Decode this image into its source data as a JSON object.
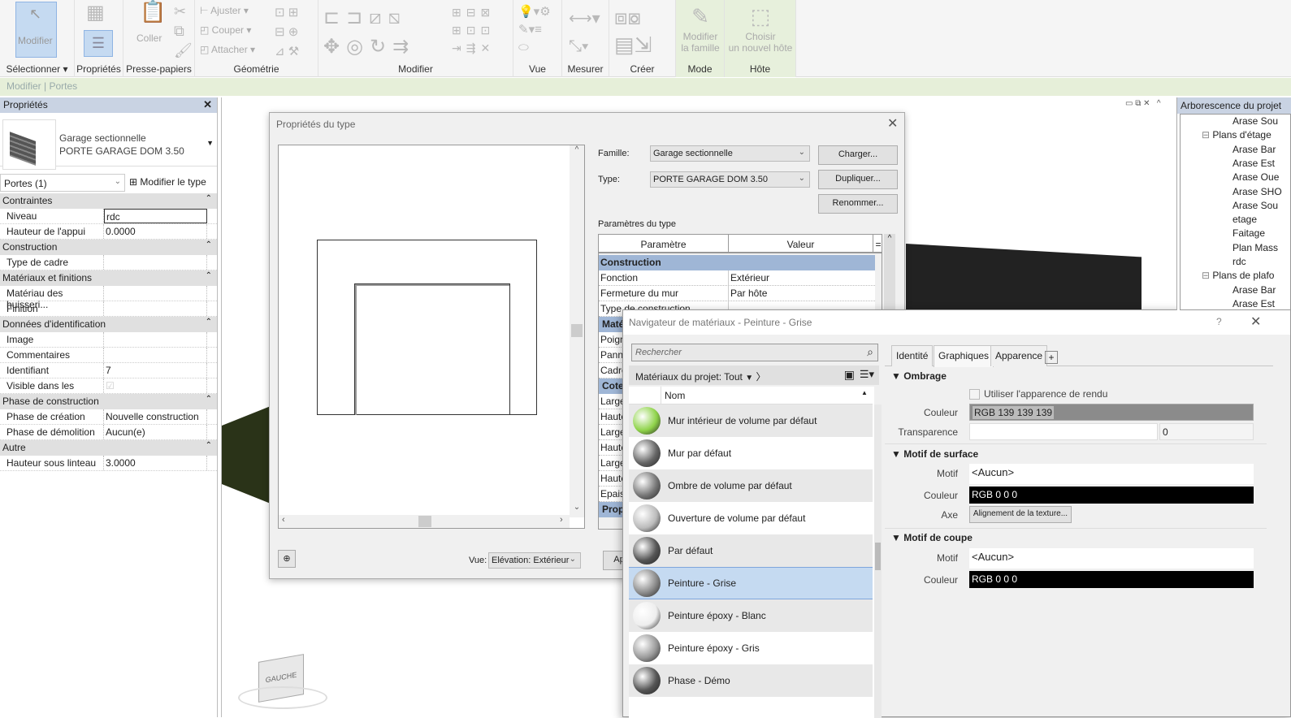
{
  "ribbon": {
    "modify": "Modifier",
    "coller": "Coller",
    "ajuster": "Ajuster",
    "couper": "Couper",
    "attacher": "Attacher",
    "modifier_famille_1": "Modifier",
    "modifier_famille_2": "la famille",
    "choisir_hote_1": "Choisir",
    "choisir_hote_2": "un nouvel hôte",
    "panels": [
      "Sélectionner ▾",
      "Propriétés",
      "Presse-papiers",
      "Géométrie",
      "Modifier",
      "Vue",
      "Mesurer",
      "Créer",
      "Mode",
      "Hôte"
    ]
  },
  "context_bar": "Modifier | Portes",
  "properties": {
    "title": "Propriétés",
    "family": "Garage sectionnelle",
    "type": "PORTE GARAGE DOM 3.50",
    "filter": "Portes (1)",
    "edit_type": "Modifier le type",
    "groups": [
      {
        "name": "Contraintes",
        "rows": [
          [
            "Niveau",
            "rdc"
          ],
          [
            "Hauteur de l'appui",
            "0.0000"
          ]
        ]
      },
      {
        "name": "Construction",
        "rows": [
          [
            "Type de cadre",
            ""
          ]
        ]
      },
      {
        "name": "Matériaux et finitions",
        "rows": [
          [
            "Matériau des huisseri...",
            ""
          ],
          [
            "Finition",
            ""
          ]
        ]
      },
      {
        "name": "Données d'identification",
        "rows": [
          [
            "Image",
            ""
          ],
          [
            "Commentaires",
            ""
          ],
          [
            "Identifiant",
            "7"
          ],
          [
            "Visible dans les nom...",
            "☑"
          ]
        ]
      },
      {
        "name": "Phase de construction",
        "rows": [
          [
            "Phase de création",
            "Nouvelle construction"
          ],
          [
            "Phase de démolition",
            "Aucun(e)"
          ]
        ]
      },
      {
        "name": "Autre",
        "rows": [
          [
            "Hauteur sous linteau",
            "3.0000"
          ]
        ]
      }
    ]
  },
  "type_props": {
    "title": "Propriétés du type",
    "famille_label": "Famille:",
    "famille": "Garage sectionnelle",
    "type_label": "Type:",
    "type": "PORTE GARAGE DOM 3.50",
    "charger": "Charger...",
    "dupliquer": "Dupliquer...",
    "renommer": "Renommer...",
    "params_label": "Paramètres du type",
    "col_param": "Paramètre",
    "col_value": "Valeur",
    "col_eq": "=",
    "construction_header": "Construction",
    "construction_rows": [
      [
        "Fonction",
        "Extérieur"
      ],
      [
        "Fermeture du mur",
        "Par hôte"
      ],
      [
        "Type de construction",
        ""
      ]
    ],
    "partial": [
      {
        "t": "g",
        "s": "Maté"
      },
      {
        "t": "r",
        "s": "Poign"
      },
      {
        "t": "r",
        "s": "Panne"
      },
      {
        "t": "r",
        "s": "Cadre"
      },
      {
        "t": "g",
        "s": "Cotes"
      },
      {
        "t": "r",
        "s": "Large"
      },
      {
        "t": "r",
        "s": "Haute"
      },
      {
        "t": "r",
        "s": "Large"
      },
      {
        "t": "r",
        "s": "Haute"
      },
      {
        "t": "r",
        "s": "Large"
      },
      {
        "t": "r",
        "s": "Haute"
      },
      {
        "t": "r",
        "s": "Epais"
      },
      {
        "t": "g",
        "s": "Prop"
      }
    ],
    "view_label": "Vue:",
    "view": "Elévation: Extérieur",
    "apply": "Ap"
  },
  "material_browser": {
    "title": "Navigateur de matériaux - Peinture - Grise",
    "help": "?",
    "search_placeholder": "Rechercher",
    "filter": "Matériaux du projet: Tout",
    "col_name": "Nom",
    "materials": [
      {
        "name": "Mur intérieur de volume par défaut",
        "color": "#8fd34a"
      },
      {
        "name": "Mur par défaut",
        "color": "#666666"
      },
      {
        "name": "Ombre de volume par défaut",
        "color": "#777777"
      },
      {
        "name": "Ouverture de volume par défaut",
        "color": "#bbbbbb"
      },
      {
        "name": "Par défaut",
        "color": "#555555"
      },
      {
        "name": "Peinture - Grise",
        "color": "#8b8b8b",
        "selected": true
      },
      {
        "name": "Peinture époxy - Blanc",
        "color": "#eeeeee"
      },
      {
        "name": "Peinture époxy - Gris",
        "color": "#999999"
      },
      {
        "name": "Phase - Démo",
        "color": "#555555"
      }
    ],
    "tabs": [
      "Identité",
      "Graphiques",
      "Apparence",
      "+"
    ],
    "ombrage": "Ombrage",
    "use_render": "Utiliser l'apparence de rendu",
    "couleur": "Couleur",
    "shade_color": "RGB 139 139 139",
    "shade_hex": "#8b8b8b",
    "transparence": "Transparence",
    "transparence_value": "0",
    "surface": "Motif de surface",
    "motif": "Motif",
    "surface_motif": "<Aucun>",
    "surface_color": "RGB 0 0 0",
    "axe": "Axe",
    "align": "Alignement de la texture...",
    "coupe": "Motif de coupe",
    "coupe_motif": "<Aucun>",
    "coupe_color": "RGB 0 0 0"
  },
  "project_browser": {
    "title": "Arborescence du projet",
    "nodes": [
      {
        "label": "Arase Sou",
        "lvl": 2
      },
      {
        "label": "Plans d'étage",
        "lvl": 1
      },
      {
        "label": "Arase Bar",
        "lvl": 2
      },
      {
        "label": "Arase Est",
        "lvl": 2
      },
      {
        "label": "Arase Oue",
        "lvl": 2
      },
      {
        "label": "Arase SHO",
        "lvl": 2
      },
      {
        "label": "Arase Sou",
        "lvl": 2
      },
      {
        "label": "etage",
        "lvl": 2
      },
      {
        "label": "Faitage",
        "lvl": 2
      },
      {
        "label": "Plan Mass",
        "lvl": 2
      },
      {
        "label": "rdc",
        "lvl": 2
      },
      {
        "label": "Plans de plafo",
        "lvl": 1
      },
      {
        "label": "Arase Bar",
        "lvl": 2
      },
      {
        "label": "Arase Est",
        "lvl": 2
      }
    ]
  },
  "viewcube": "GAUCHE"
}
